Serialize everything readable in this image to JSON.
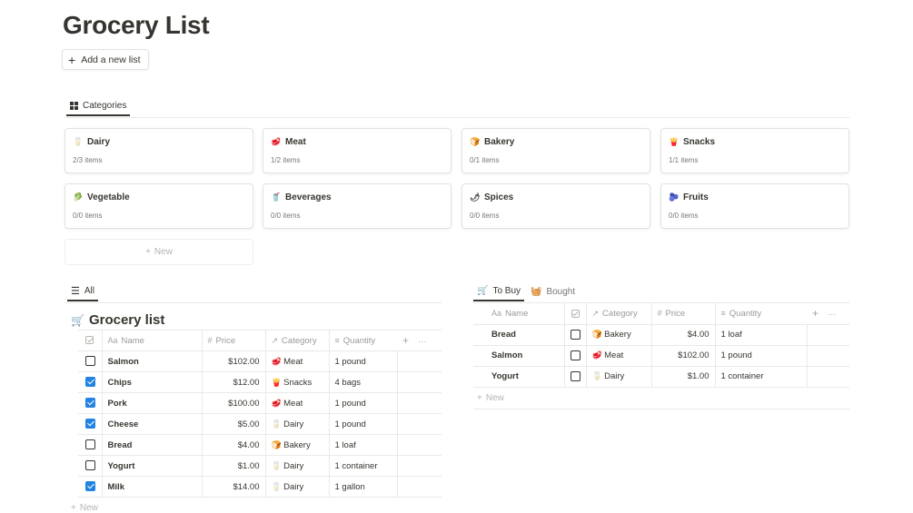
{
  "page": {
    "title": "Grocery List",
    "add_list_label": "Add a new list"
  },
  "categories_view": {
    "tab_label": "Categories",
    "cards": [
      {
        "name": "Dairy",
        "count": "2/3 items",
        "emoji": "🥛"
      },
      {
        "name": "Meat",
        "count": "1/2 items",
        "emoji": "🥩"
      },
      {
        "name": "Bakery",
        "count": "0/1 items",
        "emoji": "🍞"
      },
      {
        "name": "Snacks",
        "count": "1/1 items",
        "emoji": "🍟"
      },
      {
        "name": "Vegetable",
        "count": "0/0 items",
        "emoji": "🥬"
      },
      {
        "name": "Beverages",
        "count": "0/0 items",
        "emoji": "🥤"
      },
      {
        "name": "Spices",
        "count": "0/0 items",
        "emoji": "🌶"
      },
      {
        "name": "Fruits",
        "count": "0/0 items",
        "emoji": "🫐"
      }
    ],
    "new_label": "New"
  },
  "all_view": {
    "tab_label": "All",
    "table_title": "Grocery list",
    "columns": {
      "name": "Name",
      "price": "Price",
      "category": "Category",
      "quantity": "Quantity"
    },
    "rows": [
      {
        "checked": false,
        "name": "Salmon",
        "price": "$102.00",
        "category": "Meat",
        "category_emoji": "🥩",
        "quantity": "1 pound"
      },
      {
        "checked": true,
        "name": "Chips",
        "price": "$12.00",
        "category": "Snacks",
        "category_emoji": "🍟",
        "quantity": "4 bags"
      },
      {
        "checked": true,
        "name": "Pork",
        "price": "$100.00",
        "category": "Meat",
        "category_emoji": "🥩",
        "quantity": "1 pound"
      },
      {
        "checked": true,
        "name": "Cheese",
        "price": "$5.00",
        "category": "Dairy",
        "category_emoji": "🥛",
        "quantity": "1 pound"
      },
      {
        "checked": false,
        "name": "Bread",
        "price": "$4.00",
        "category": "Bakery",
        "category_emoji": "🍞",
        "quantity": "1 loaf"
      },
      {
        "checked": false,
        "name": "Yogurt",
        "price": "$1.00",
        "category": "Dairy",
        "category_emoji": "🥛",
        "quantity": "1 container"
      },
      {
        "checked": true,
        "name": "Milk",
        "price": "$14.00",
        "category": "Dairy",
        "category_emoji": "🥛",
        "quantity": "1 gallon"
      }
    ],
    "new_label": "New"
  },
  "to_buy_view": {
    "tabs": [
      "To Buy",
      "Bought"
    ],
    "columns": {
      "name": "Name",
      "category": "Category",
      "price": "Price",
      "quantity": "Quantity"
    },
    "rows": [
      {
        "checked": false,
        "name": "Bread",
        "category": "Bakery",
        "category_emoji": "🍞",
        "price": "$4.00",
        "quantity": "1 loaf"
      },
      {
        "checked": false,
        "name": "Salmon",
        "category": "Meat",
        "category_emoji": "🥩",
        "price": "$102.00",
        "quantity": "1 pound"
      },
      {
        "checked": false,
        "name": "Yogurt",
        "category": "Dairy",
        "category_emoji": "🥛",
        "price": "$1.00",
        "quantity": "1 container"
      }
    ],
    "new_label": "New"
  },
  "icons": {
    "plus": "+",
    "more": "···",
    "name_prefix": "Aa",
    "number": "#",
    "relation": "↗",
    "text_lines": "≡",
    "list": "☰",
    "cart": "🛒",
    "basket": "🧺"
  },
  "colors": {
    "checkbox_blue": "#2383e2",
    "text": "#37352f",
    "muted": "#787774"
  }
}
